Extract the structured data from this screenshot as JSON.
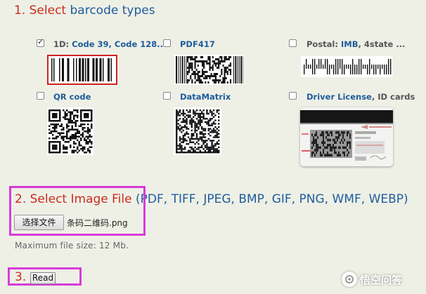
{
  "step1": {
    "num": "1.",
    "select": "Select",
    "rest": "barcode types"
  },
  "options": [
    {
      "prefix": "1D: ",
      "link": "Code 39, Code 128...",
      "checked": true
    },
    {
      "link": "PDF417",
      "checked": false
    },
    {
      "prefix": "Postal: ",
      "link": "IMB",
      "suffix": ", 4state ...",
      "checked": false
    },
    {
      "link": "QR code",
      "checked": false
    },
    {
      "link": "DataMatrix",
      "checked": false
    },
    {
      "link": "Driver License",
      "suffix": ", ID cards",
      "checked": false
    }
  ],
  "step2": {
    "num": "2.",
    "title": "Select Image File",
    "paren_open": "(",
    "paren_close": ")",
    "formats": [
      "PDF,",
      "TIFF,",
      "JPEG,",
      "BMP,",
      "GIF,",
      "PNG,",
      "WMF,",
      "WEBP"
    ]
  },
  "file": {
    "button_label": "选择文件",
    "selected_name": "条码二维码.png",
    "max_size": "Maximum file size: 12 Mb."
  },
  "step3": {
    "num": "3.",
    "button_label": "Read"
  },
  "watermark": {
    "text": "悟空问答"
  },
  "colors": {
    "red": "#cc2b1d",
    "blue": "#1f5c9c",
    "highlight": "#d93bd9",
    "selected_border": "#cc2222"
  }
}
